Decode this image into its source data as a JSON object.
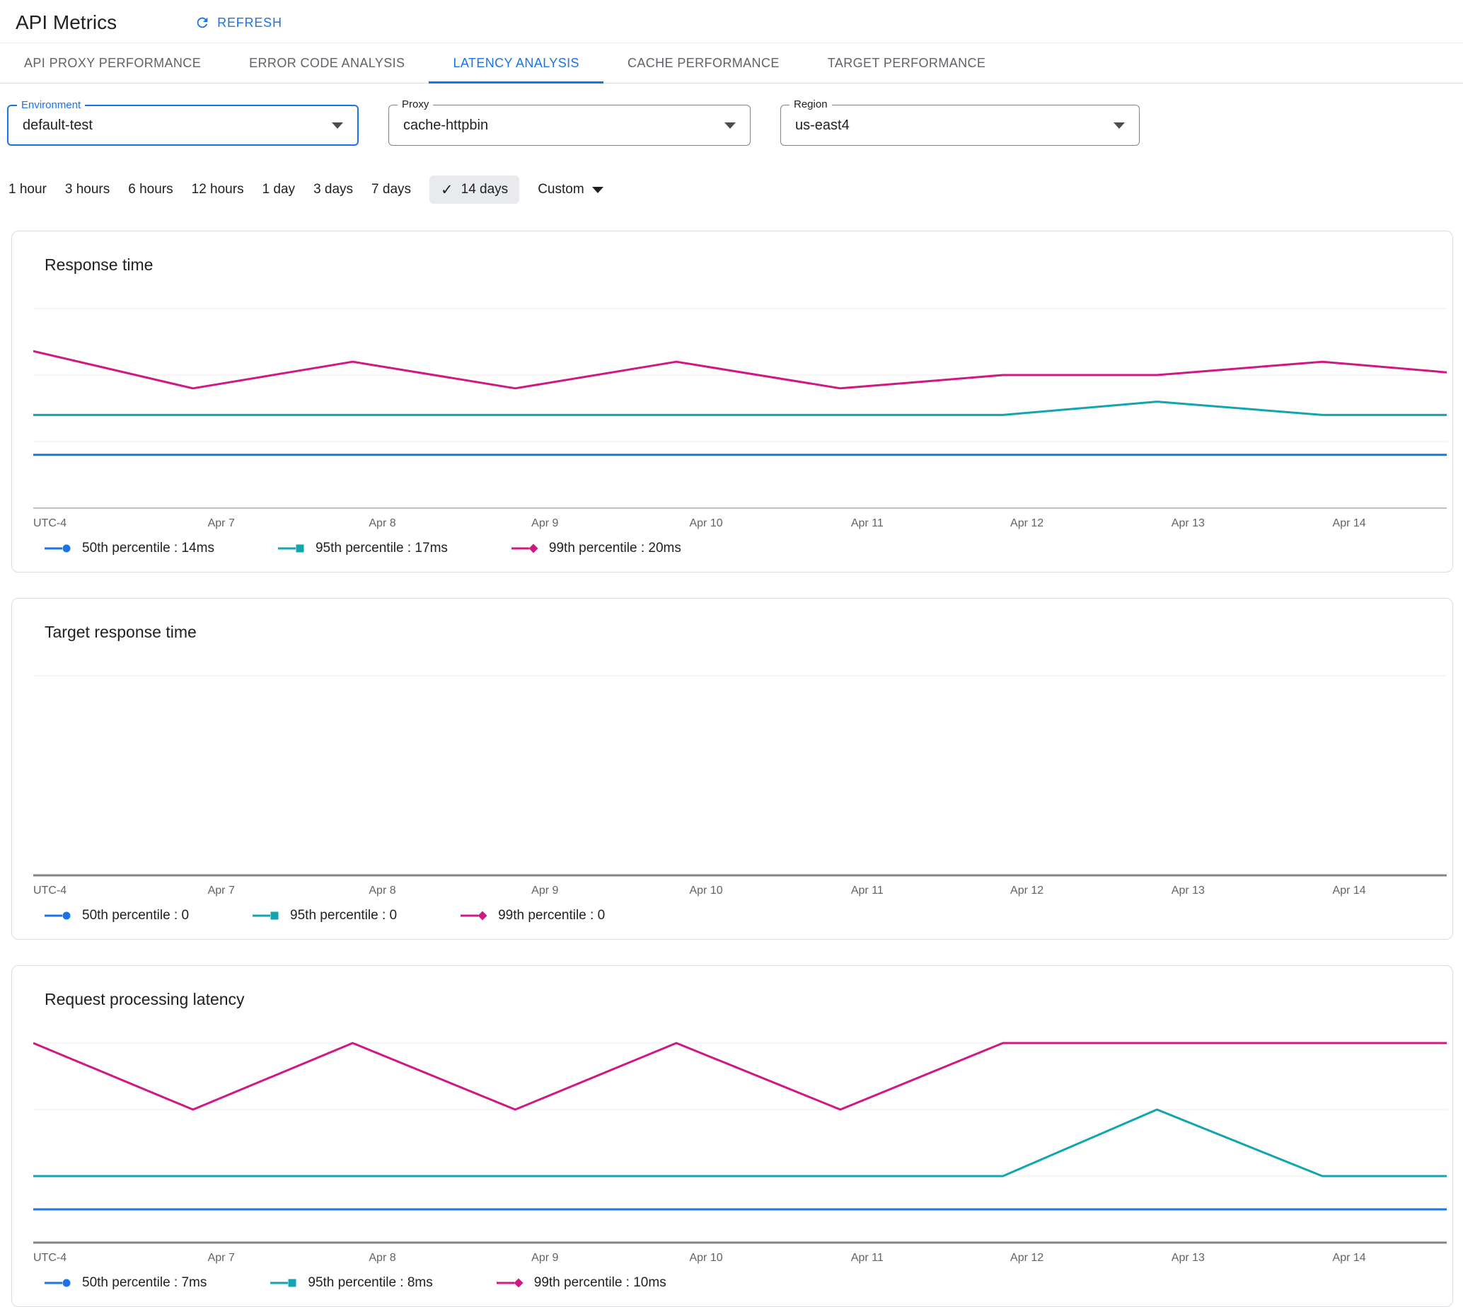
{
  "header": {
    "title": "API Metrics",
    "refresh_label": "REFRESH"
  },
  "tabs": [
    {
      "label": "API PROXY PERFORMANCE",
      "active": false
    },
    {
      "label": "ERROR CODE ANALYSIS",
      "active": false
    },
    {
      "label": "LATENCY ANALYSIS",
      "active": true
    },
    {
      "label": "CACHE PERFORMANCE",
      "active": false
    },
    {
      "label": "TARGET PERFORMANCE",
      "active": false
    }
  ],
  "filters": [
    {
      "label": "Environment",
      "value": "default-test",
      "focused": true
    },
    {
      "label": "Proxy",
      "value": "cache-httpbin",
      "focused": false
    },
    {
      "label": "Region",
      "value": "us-east4",
      "focused": false
    }
  ],
  "time_ranges": {
    "options": [
      "1 hour",
      "3 hours",
      "6 hours",
      "12 hours",
      "1 day",
      "3 days",
      "7 days",
      "14 days"
    ],
    "selected": "14 days",
    "custom_label": "Custom",
    "check_icon": "✓"
  },
  "colors": {
    "accent": "#1a73e8",
    "series_50th": "#1a73e8",
    "series_95th": "#12a4af",
    "series_99th": "#d01884"
  },
  "chart_data": [
    {
      "type": "line",
      "title": "Response time",
      "x_note": "UTC-4",
      "x_ticks": [
        {
          "label": "Apr 7",
          "x": 0.133
        },
        {
          "label": "Apr 8",
          "x": 0.247
        },
        {
          "label": "Apr 9",
          "x": 0.362
        },
        {
          "label": "Apr 10",
          "x": 0.476
        },
        {
          "label": "Apr 11",
          "x": 0.59
        },
        {
          "label": "Apr 12",
          "x": 0.703
        },
        {
          "label": "Apr 13",
          "x": 0.817
        },
        {
          "label": "Apr 14",
          "x": 0.931
        }
      ],
      "ylim": [
        10,
        25
      ],
      "y_step": 5,
      "axis_color": "#bdc1c6",
      "axis_width": 2,
      "grid": true,
      "legend_position": "bottom",
      "series": [
        {
          "name": "50th percentile",
          "legend_text": "50th percentile : 14ms",
          "color": "#1a73e8",
          "marker": "circle",
          "points": [
            [
              0,
              14
            ],
            [
              1,
              14
            ]
          ]
        },
        {
          "name": "95th percentile",
          "legend_text": "95th percentile : 17ms",
          "color": "#12a4af",
          "marker": "square",
          "points": [
            [
              0,
              17
            ],
            [
              0.686,
              17
            ],
            [
              0.795,
              18
            ],
            [
              0.912,
              17
            ],
            [
              1,
              17
            ]
          ]
        },
        {
          "name": "99th percentile",
          "legend_text": "99th percentile : 20ms",
          "color": "#d01884",
          "marker": "diamond",
          "points": [
            [
              0,
              21.8
            ],
            [
              0.113,
              19
            ],
            [
              0.226,
              21
            ],
            [
              0.341,
              19
            ],
            [
              0.455,
              21
            ],
            [
              0.571,
              19
            ],
            [
              0.686,
              20
            ],
            [
              0.795,
              20
            ],
            [
              0.912,
              21
            ],
            [
              1,
              20.2
            ]
          ]
        }
      ]
    },
    {
      "type": "line",
      "title": "Target response time",
      "x_note": "UTC-4",
      "x_ticks": [
        {
          "label": "Apr 7",
          "x": 0.133
        },
        {
          "label": "Apr 8",
          "x": 0.247
        },
        {
          "label": "Apr 9",
          "x": 0.362
        },
        {
          "label": "Apr 10",
          "x": 0.476
        },
        {
          "label": "Apr 11",
          "x": 0.59
        },
        {
          "label": "Apr 12",
          "x": 0.703
        },
        {
          "label": "Apr 13",
          "x": 0.817
        },
        {
          "label": "Apr 14",
          "x": 0.931
        }
      ],
      "ylim": null,
      "axis_color": "#80868b",
      "axis_width": 3,
      "grid": false,
      "legend_position": "bottom",
      "series": [
        {
          "name": "50th percentile",
          "legend_text": "50th percentile : 0",
          "color": "#1a73e8",
          "marker": "circle",
          "points": []
        },
        {
          "name": "95th percentile",
          "legend_text": "95th percentile : 0",
          "color": "#12a4af",
          "marker": "square",
          "points": []
        },
        {
          "name": "99th percentile",
          "legend_text": "99th percentile : 0",
          "color": "#d01884",
          "marker": "diamond",
          "points": []
        }
      ]
    },
    {
      "type": "line",
      "title": "Request processing latency",
      "x_note": "UTC-4",
      "x_ticks": [
        {
          "label": "Apr 7",
          "x": 0.133
        },
        {
          "label": "Apr 8",
          "x": 0.247
        },
        {
          "label": "Apr 9",
          "x": 0.362
        },
        {
          "label": "Apr 10",
          "x": 0.476
        },
        {
          "label": "Apr 11",
          "x": 0.59
        },
        {
          "label": "Apr 12",
          "x": 0.703
        },
        {
          "label": "Apr 13",
          "x": 0.817
        },
        {
          "label": "Apr 14",
          "x": 0.931
        }
      ],
      "ylim": [
        6,
        12
      ],
      "y_step": 2,
      "axis_color": "#80868b",
      "axis_width": 3,
      "grid": true,
      "legend_position": "bottom",
      "series": [
        {
          "name": "50th percentile",
          "legend_text": "50th percentile : 7ms",
          "color": "#1a73e8",
          "marker": "circle",
          "points": [
            [
              0,
              7
            ],
            [
              1,
              7
            ]
          ]
        },
        {
          "name": "95th percentile",
          "legend_text": "95th percentile : 8ms",
          "color": "#12a4af",
          "marker": "square",
          "points": [
            [
              0,
              8
            ],
            [
              0.686,
              8
            ],
            [
              0.795,
              10
            ],
            [
              0.912,
              8
            ],
            [
              1,
              8
            ]
          ]
        },
        {
          "name": "99th percentile",
          "legend_text": "99th percentile : 10ms",
          "color": "#d01884",
          "marker": "diamond",
          "points": [
            [
              0,
              12
            ],
            [
              0.113,
              10
            ],
            [
              0.226,
              12
            ],
            [
              0.341,
              10
            ],
            [
              0.455,
              12
            ],
            [
              0.571,
              10
            ],
            [
              0.686,
              12
            ],
            [
              1,
              12
            ]
          ]
        }
      ]
    }
  ]
}
